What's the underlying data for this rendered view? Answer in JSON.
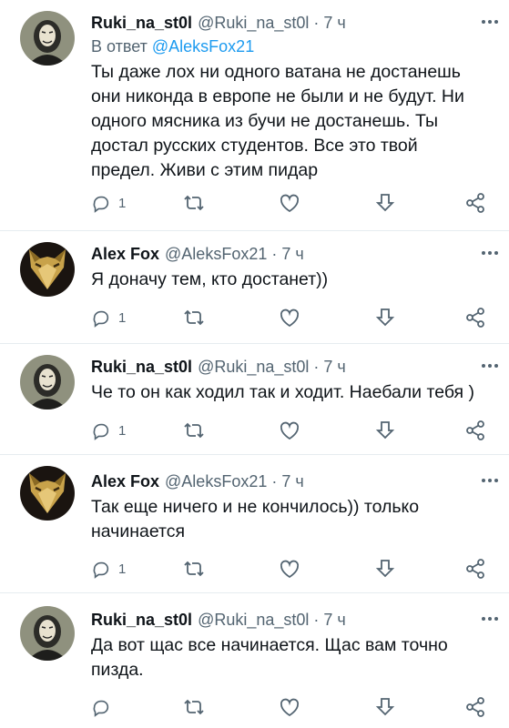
{
  "tweets": [
    {
      "name": "Ruki_na_st0l",
      "handle": "@Ruki_na_st0l",
      "dot": "·",
      "time": "7 ч",
      "reply_prefix": "В ответ ",
      "reply_mention": "@AleksFox21",
      "text_lines": [
        "Ты даже лох ни одного ватана не достанешь",
        "они никонда в европе не были и не будут. Ни",
        "одного мясника из бучи не достанешь. Ты",
        "достал русских студентов. Все это твой",
        "предел. Живи с этим пидар"
      ],
      "reply_count": "1",
      "avatar": "masked-figure"
    },
    {
      "name": "Alex Fox",
      "handle": "@AleksFox21",
      "dot": "·",
      "time": "7 ч",
      "text_lines": [
        "Я доначу тем, кто достанет))"
      ],
      "reply_count": "1",
      "avatar": "gold-fox-mask"
    },
    {
      "name": "Ruki_na_st0l",
      "handle": "@Ruki_na_st0l",
      "dot": "·",
      "time": "7 ч",
      "text_lines": [
        "Че то он как ходил так и ходит. Наебали тебя )"
      ],
      "reply_count": "1",
      "avatar": "masked-figure"
    },
    {
      "name": "Alex Fox",
      "handle": "@AleksFox21",
      "dot": "·",
      "time": "7 ч",
      "text_lines": [
        "Так еще ничего и не кончилось)) только",
        "начинается"
      ],
      "reply_count": "1",
      "avatar": "gold-fox-mask"
    },
    {
      "name": "Ruki_na_st0l",
      "handle": "@Ruki_na_st0l",
      "dot": "·",
      "time": "7 ч",
      "text_lines": [
        "Да вот щас все начинается. Щас вам точно",
        "пизда."
      ],
      "reply_count": "",
      "avatar": "masked-figure"
    }
  ],
  "icons": {
    "reply": "reply-icon",
    "retweet": "retweet-icon",
    "like": "like-icon",
    "bookmark": "bookmark-icon",
    "share": "share-icon",
    "more": "more-icon"
  },
  "colors": {
    "text": "#0f1419",
    "secondary": "#536471",
    "link": "#1d9bf0",
    "divider": "#e6ecf0"
  }
}
